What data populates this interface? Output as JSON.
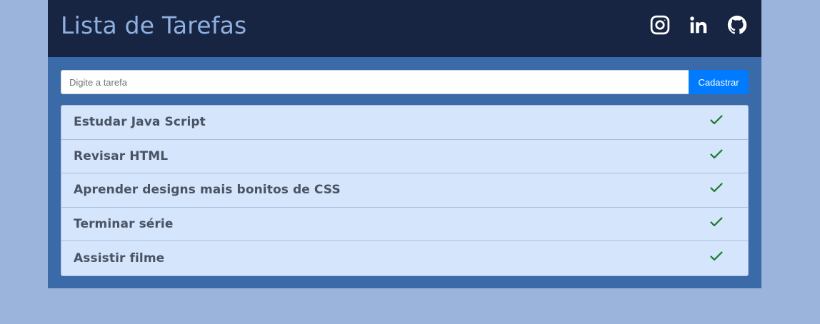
{
  "header": {
    "title": "Lista de Tarefas",
    "icons": [
      "instagram-icon",
      "linkedin-icon",
      "github-icon"
    ]
  },
  "form": {
    "input_placeholder": "Digite a tarefa",
    "input_value": "",
    "submit_label": "Cadastrar"
  },
  "tasks": [
    {
      "label": "Estudar Java Script",
      "icon": "check-icon"
    },
    {
      "label": "Revisar HTML",
      "icon": "check-icon"
    },
    {
      "label": "Aprender designs mais bonitos de CSS",
      "icon": "check-icon"
    },
    {
      "label": "Terminar série",
      "icon": "check-icon"
    },
    {
      "label": "Assistir filme",
      "icon": "check-icon"
    }
  ],
  "colors": {
    "page_background": "#9bb4db",
    "header_background": "#172542",
    "card_background": "#3b6aa9",
    "title_color": "#8fb0e0",
    "button_color": "#007bff",
    "list_background": "#d4e5fc",
    "check_color": "#1a7a28"
  }
}
